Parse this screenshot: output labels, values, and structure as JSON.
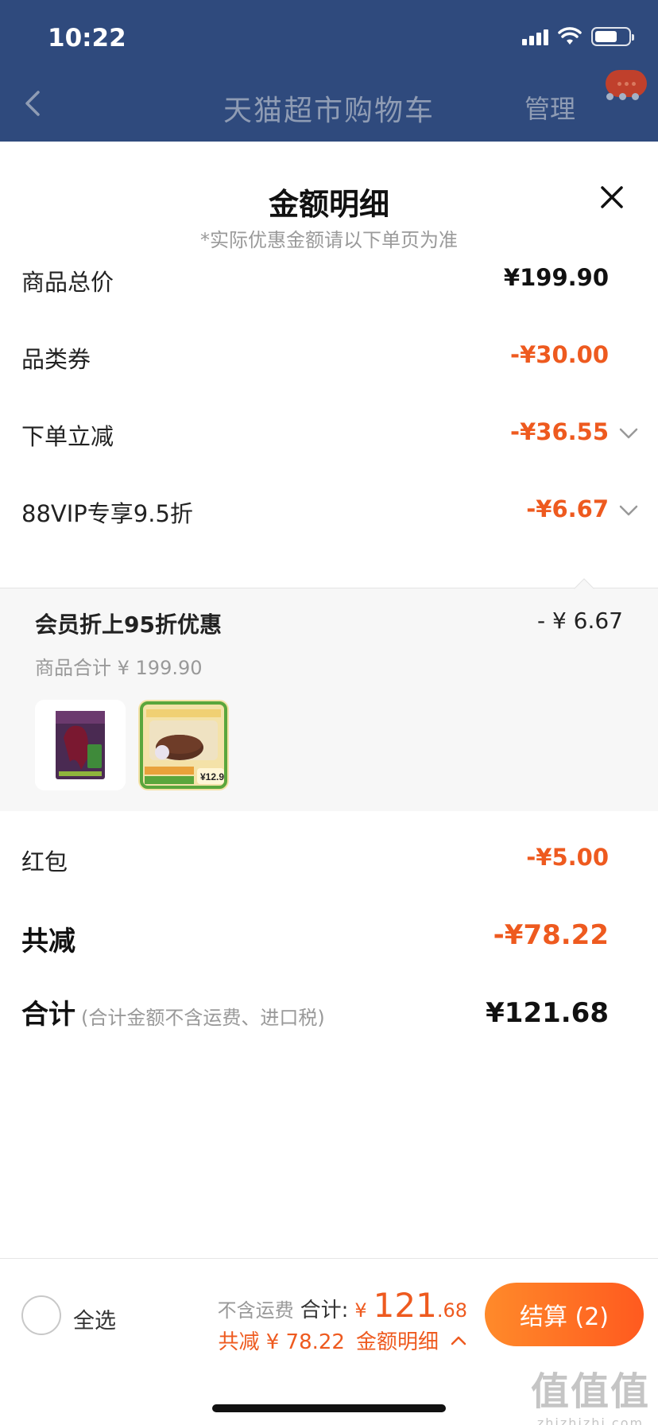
{
  "status_bar": {
    "time": "10:22"
  },
  "nav": {
    "title": "天猫超市购物车",
    "manage": "管理"
  },
  "sheet": {
    "title": "金额明细",
    "subtitle": "*实际优惠金额请以下单页为准",
    "rows": [
      {
        "label": "商品总价",
        "value": "¥199.90"
      },
      {
        "label": "品类券",
        "value": "-¥30.00"
      },
      {
        "label": "下单立减",
        "value": "-¥36.55"
      },
      {
        "label": "88VIP专享9.5折",
        "value": "-¥6.67"
      },
      {
        "label": "红包",
        "value": "-¥5.00"
      }
    ],
    "vip_panel": {
      "title": "会员折上95折优惠",
      "amount": "- ¥ 6.67",
      "subtotal": "商品合计 ¥ 199.90"
    },
    "total_discount": {
      "label": "共减",
      "value": "-¥78.22"
    },
    "sum": {
      "label": "合计",
      "note": "(合计金额不含运费、进口税)",
      "value": "¥121.68"
    }
  },
  "bottom_bar": {
    "select_all": "全选",
    "no_freight": "不含运费",
    "total_label": "合计:",
    "currency": "¥",
    "total_int": "121",
    "total_dec": ".68",
    "discount_text": "共减 ¥ 78.22",
    "detail_link": "金额明细",
    "checkout": "结算 (2)"
  },
  "watermark": {
    "main": "值值值",
    "sub": "zhizhizhi.com"
  },
  "colors": {
    "accent": "#ee5a1f",
    "header": "#2f4a7d"
  },
  "icons": [
    "back-icon",
    "more-icon",
    "close-icon",
    "chevron-down-icon",
    "chevron-up-icon"
  ]
}
